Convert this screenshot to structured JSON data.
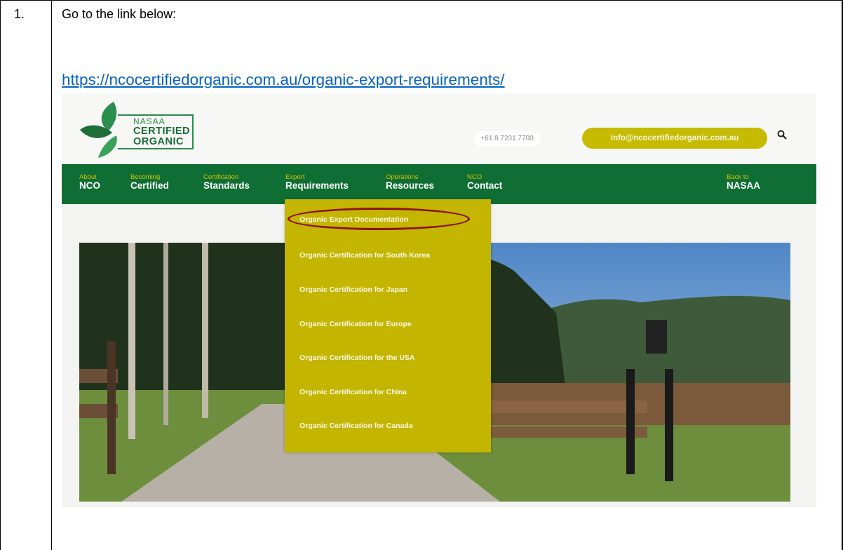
{
  "step": {
    "number": "1.",
    "instruction": "Go to the link below:",
    "link": "https://ncocertifiedorganic.com.au/organic-export-requirements/"
  },
  "website": {
    "logo": {
      "line1": "NASAA",
      "line2": "CERTIFIED",
      "line3": "ORGANIC"
    },
    "phone": "+61 8 7231 7700",
    "email": "info@ncocertifiedorganic.com.au",
    "nav": [
      {
        "small": "About",
        "big": "NCO"
      },
      {
        "small": "Becoming",
        "big": "Certified"
      },
      {
        "small": "Certification",
        "big": "Standards"
      },
      {
        "small": "Export",
        "big": "Requirements"
      },
      {
        "small": "Operations",
        "big": "Resources"
      },
      {
        "small": "NCO",
        "big": "Contact"
      },
      {
        "small": "Back to",
        "big": "NASAA"
      }
    ],
    "dropdown": [
      "Organic Export Documentation",
      "Organic Certification for South Korea",
      "Organic Certification for Japan",
      "Organic Certification for Europe",
      "Organic Certification for the USA",
      "Organic Certification for China",
      "Organic Certification for Canada"
    ],
    "colors": {
      "nav_green": "#0f6e34",
      "accent_yellow": "#c6bb00",
      "highlight_red": "#8b1414",
      "link_blue": "#0563c1"
    }
  }
}
